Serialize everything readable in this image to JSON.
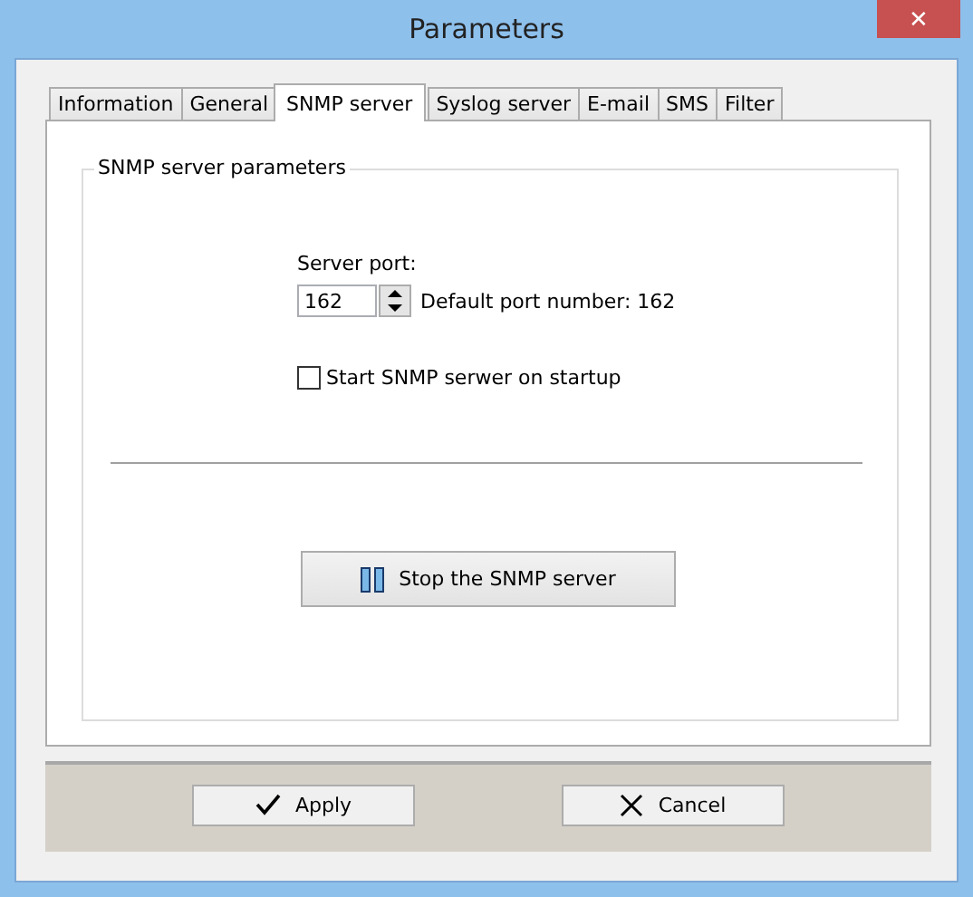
{
  "window": {
    "title": "Parameters",
    "close": "✕"
  },
  "tabs": [
    {
      "label": "Information",
      "selected": false
    },
    {
      "label": "General",
      "selected": false
    },
    {
      "label": "SNMP server",
      "selected": true
    },
    {
      "label": "Syslog server",
      "selected": false
    },
    {
      "label": "E-mail",
      "selected": false
    },
    {
      "label": "SMS",
      "selected": false
    },
    {
      "label": "Filter",
      "selected": false
    }
  ],
  "group": {
    "title": "SNMP server parameters"
  },
  "server_port": {
    "label": "Server port:",
    "value": "162",
    "hint": "Default port number: 162"
  },
  "startup_checkbox": {
    "label": "Start SNMP serwer on startup",
    "checked": false
  },
  "stop_button": {
    "label": "Stop the SNMP server"
  },
  "buttons": [
    {
      "kind": "apply",
      "label": "Apply"
    },
    {
      "kind": "cancel",
      "label": "Cancel"
    }
  ]
}
